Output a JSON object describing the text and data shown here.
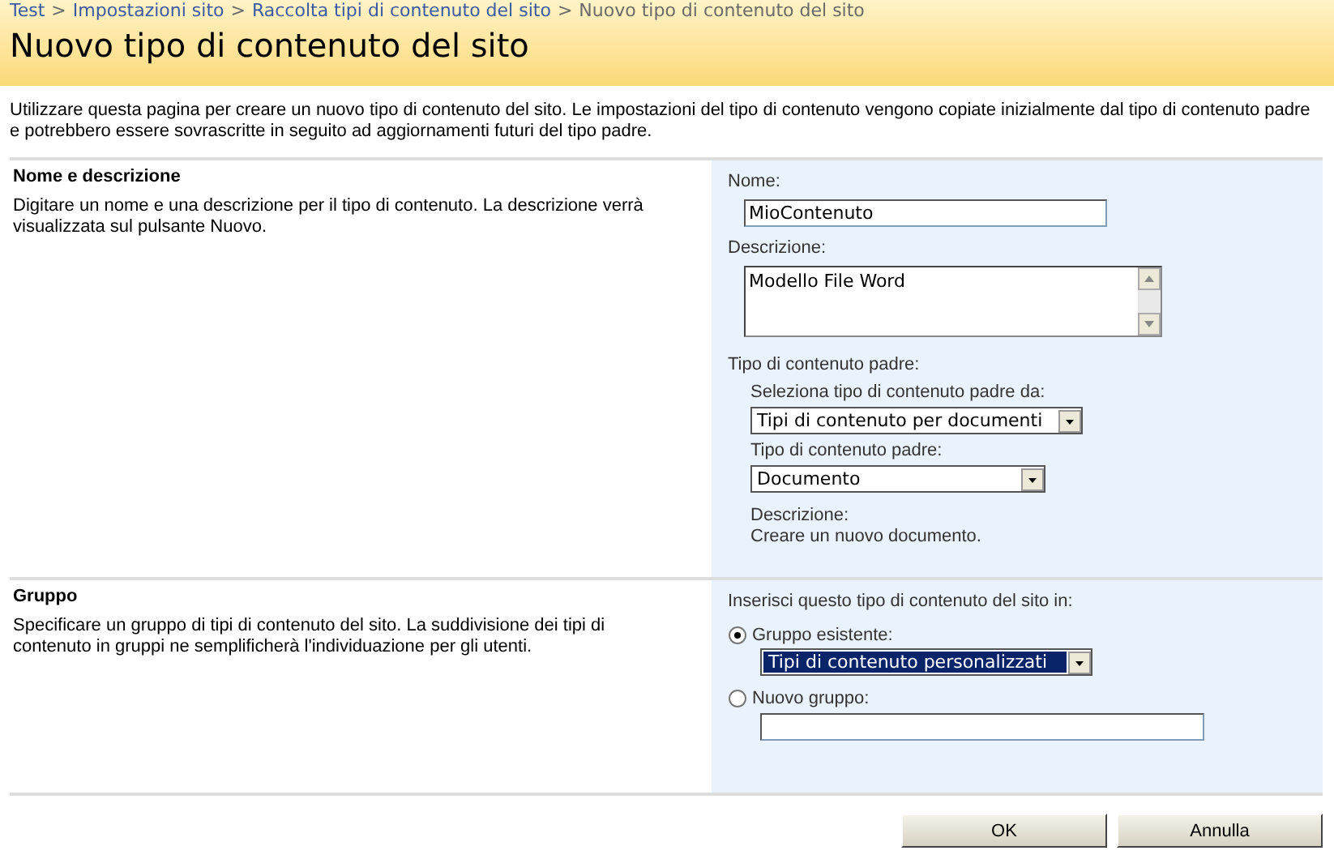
{
  "breadcrumb": {
    "separator": ">",
    "items": [
      {
        "label": "Test",
        "kind": "link"
      },
      {
        "label": "Impostazioni sito",
        "kind": "link"
      },
      {
        "label": "Raccolta tipi di contenuto del sito",
        "kind": "link"
      },
      {
        "label": "Nuovo tipo di contenuto del sito",
        "kind": "current"
      }
    ]
  },
  "title": "Nuovo tipo di contenuto del sito",
  "intro": "Utilizzare questa pagina per creare un nuovo tipo di contenuto del sito. Le impostazioni del tipo di contenuto vengono copiate inizialmente dal tipo di contenuto padre e potrebbero essere sovrascritte in seguito ad aggiornamenti futuri del tipo padre.",
  "sections": [
    {
      "heading": "Nome e descrizione",
      "description": "Digitare un nome e una descrizione per il tipo di contenuto. La descrizione verrà visualizzata sul pulsante Nuovo.",
      "name_label": "Nome:",
      "name_value": "MioContenuto",
      "desc_label": "Descrizione:",
      "desc_value": "Modello File Word",
      "parent_label": "Tipo di contenuto padre:",
      "select_from_label": "Seleziona tipo di contenuto padre da:",
      "select_from_value": "Tipi di contenuto per documenti",
      "parent_type_label": "Tipo di contenuto padre:",
      "parent_type_value": "Documento",
      "parent_desc_label": "Descrizione:",
      "parent_desc_value": "Creare un nuovo documento."
    },
    {
      "heading": "Gruppo",
      "description": "Specificare un gruppo di tipi di contenuto del sito. La suddivisione dei tipi di contenuto in gruppi ne semplificherà l'individuazione per gli utenti.",
      "prompt": "Inserisci questo tipo di contenuto del sito in:",
      "options": [
        {
          "label": "Gruppo esistente:",
          "selected": true,
          "kind": "select",
          "value": "Tipi di contenuto personalizzati"
        },
        {
          "label": "Nuovo gruppo:",
          "selected": false,
          "kind": "text"
        }
      ]
    }
  ],
  "buttons": [
    "OK",
    "Annulla"
  ]
}
